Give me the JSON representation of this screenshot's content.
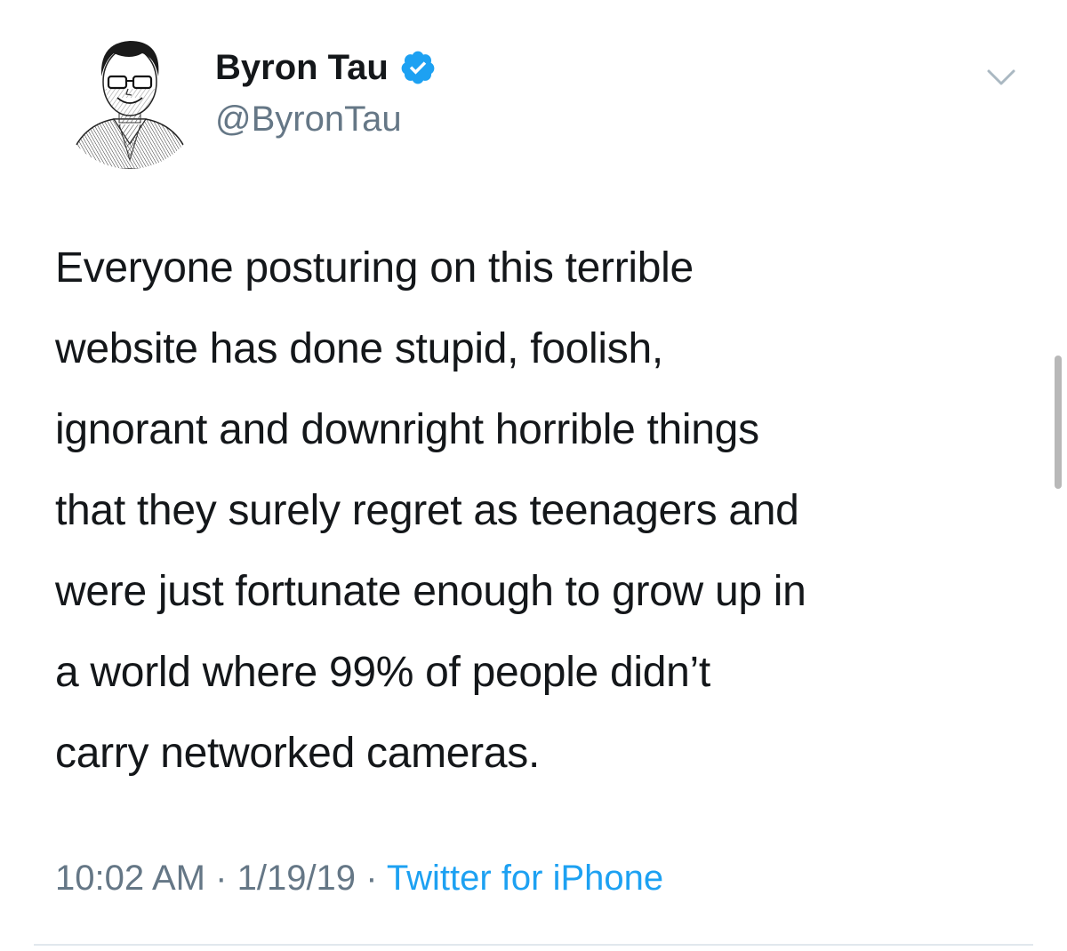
{
  "author": {
    "display_name": "Byron Tau",
    "handle": "@ByronTau",
    "verified": true,
    "avatar_icon": "profile-photo-illustration"
  },
  "tweet": {
    "text": "Everyone posturing on this terrible\nwebsite has done stupid, foolish,\nignorant and downright horrible things\nthat they surely regret as teenagers and\nwere just fortunate enough to grow up in\na world where 99% of people didn’t\ncarry networked cameras.",
    "time": "10:02 AM",
    "date": "1/19/19",
    "separator": "·",
    "source": "Twitter for iPhone"
  },
  "icons": {
    "verified": "verified-badge-icon",
    "menu": "chevron-down-icon"
  },
  "colors": {
    "text": "#14171a",
    "secondary": "#657786",
    "link": "#1da1f2",
    "divider": "#e1e8ed"
  }
}
